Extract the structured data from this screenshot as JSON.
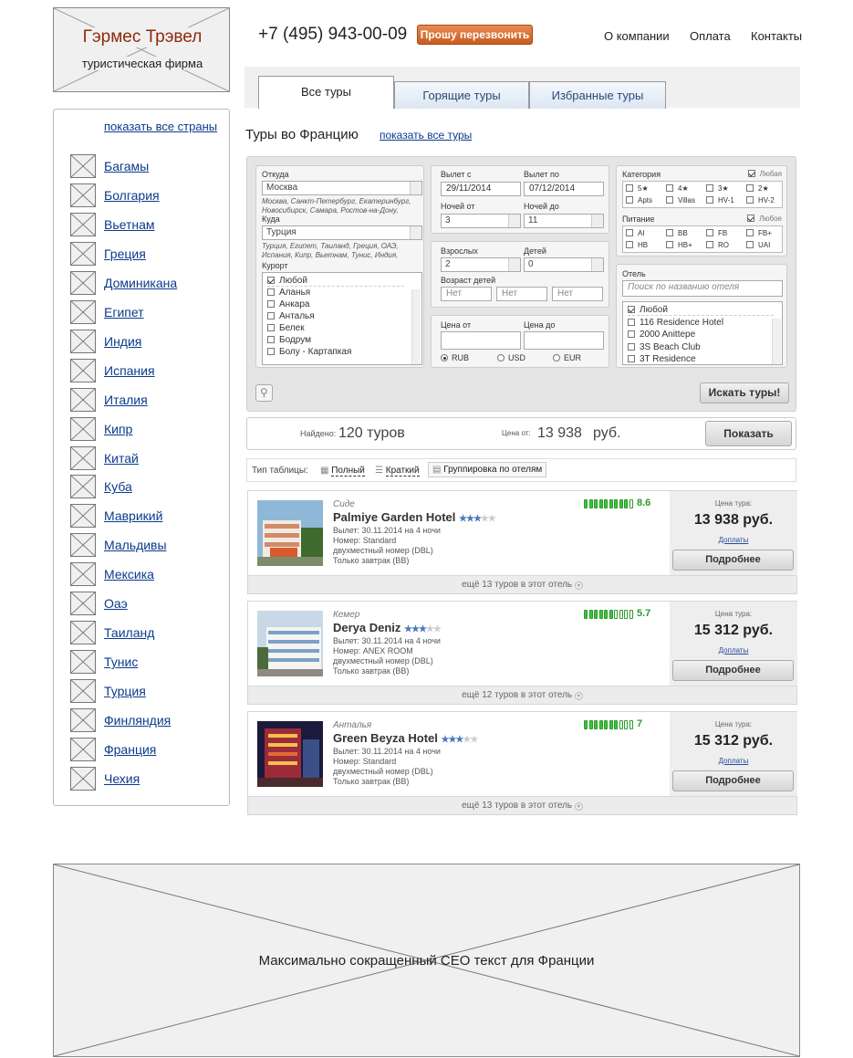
{
  "logo": {
    "title": "Гэрмес Трэвел",
    "subtitle": "туристическая фирма"
  },
  "header": {
    "phone": "+7 (495) 943-00-09",
    "callback": "Прошу перезвонить",
    "nav": [
      "О компании",
      "Оплата",
      "Контакты"
    ]
  },
  "sidebar": {
    "show_all": "показать все страны",
    "countries": [
      "Багамы",
      "Болгария",
      "Вьетнам",
      "Греция",
      "Доминикана",
      "Египет",
      "Индия",
      "Испания",
      "Италия",
      "Кипр",
      "Китай",
      "Куба",
      "Маврикий",
      "Мальдивы",
      "Мексика",
      "Оаэ",
      "Таиланд",
      "Тунис",
      "Турция",
      "Финляндия",
      "Франция",
      "Чехия"
    ]
  },
  "tabs": [
    "Все туры",
    "Горящие туры",
    "Избранные туры"
  ],
  "page": {
    "title": "Туры во Францию",
    "show_all_tours": "показать все туры"
  },
  "search": {
    "from_label": "Откуда",
    "from_value": "Москва",
    "from_hint": "Москва, Санкт-Петербург, Екатеринбург, Новосибирск, Самара, Ростов-на-Дону,",
    "to_label": "Куда",
    "to_value": "Турция",
    "to_hint": "Турция, Египет, Таиланд, Греция, ОАЭ, Испания, Кипр, Вьетнам, Тунис, Индия,",
    "resort_label": "Курорт",
    "resorts": [
      "Любой",
      "Аланья",
      "Анкара",
      "Анталья",
      "Белек",
      "Бодрум",
      "Болу - Картапкая"
    ],
    "depart_from_label": "Вылет с",
    "depart_from": "29/11/2014",
    "depart_to_label": "Вылет по",
    "depart_to": "07/12/2014",
    "nights_from_label": "Ночей от",
    "nights_from": "3",
    "nights_to_label": "Ночей до",
    "nights_to": "11",
    "adults_label": "Взрослых",
    "adults": "2",
    "children_label": "Детей",
    "children": "0",
    "child_age_label": "Возраст детей",
    "child_age_ph": "Нет",
    "price_from_label": "Цена от",
    "price_to_label": "Цена до",
    "currencies": [
      "RUB",
      "USD",
      "EUR"
    ],
    "category_label": "Категория",
    "category_any": "Любая",
    "categories": [
      "5★",
      "4★",
      "3★",
      "2★",
      "Apts",
      "Villas",
      "HV-1",
      "HV-2"
    ],
    "meal_label": "Питание",
    "meal_any": "Любое",
    "meals": [
      "AI",
      "BB",
      "FB",
      "FB+",
      "HB",
      "HB+",
      "RO",
      "UAI"
    ],
    "hotel_label": "Отель",
    "hotel_ph": "Поиск по названию отеля",
    "hotels": [
      "Любой",
      "116 Residence Hotel",
      "2000 Anittepe",
      "3S Beach Club",
      "3T Residence"
    ],
    "search_btn": "Искать туры!"
  },
  "results": {
    "found_label": "Найдено:",
    "found_value": "120 туров",
    "price_from_label": "Цена от:",
    "price_from": "13 938",
    "currency": "руб.",
    "show_btn": "Показать"
  },
  "table_type": {
    "label": "Тип таблицы:",
    "options": [
      "Полный",
      "Краткий",
      "Группировка по отелям"
    ]
  },
  "hotels": [
    {
      "city": "Сиде",
      "name": "Palmiye Garden Hotel",
      "stars": 3,
      "depart": "Вылет: 30.11.2014 на 4 ночи",
      "room": "Номер: Standard",
      "room_type": "двухместный номер (DBL)",
      "meal": "Только завтрак (BB)",
      "rating": "8.6",
      "rating_fill": 0.86,
      "price_label": "Цена тура:",
      "price": "13 938 руб.",
      "extra": "Доплаты",
      "details": "Подробнее",
      "more": "ещё 13 туров в этот отель"
    },
    {
      "city": "Кемер",
      "name": "Derya Deniz",
      "stars": 3,
      "depart": "Вылет: 30.11.2014 на 4 ночи",
      "room": "Номер: ANEX ROOM",
      "room_type": "двухместный номер (DBL)",
      "meal": "Только завтрак (BB)",
      "rating": "5.7",
      "rating_fill": 0.57,
      "price_label": "Цена тура:",
      "price": "15 312 руб.",
      "extra": "Доплаты",
      "details": "Подробнее",
      "more": "ещё 12 туров в этот отель"
    },
    {
      "city": "Анталья",
      "name": "Green Beyza Hotel",
      "stars": 3,
      "depart": "Вылет: 30.11.2014 на 4 ночи",
      "room": "Номер: Standard",
      "room_type": "двухместный номер (DBL)",
      "meal": "Только завтрак (BB)",
      "rating": "7",
      "rating_fill": 0.7,
      "price_label": "Цена тура:",
      "price": "15 312 руб.",
      "extra": "Доплаты",
      "details": "Подробнее",
      "more": "ещё 13 туров в этот отель"
    }
  ],
  "footer": {
    "seo_text": "Максимально сокращенный СЕО текст для Франции"
  }
}
